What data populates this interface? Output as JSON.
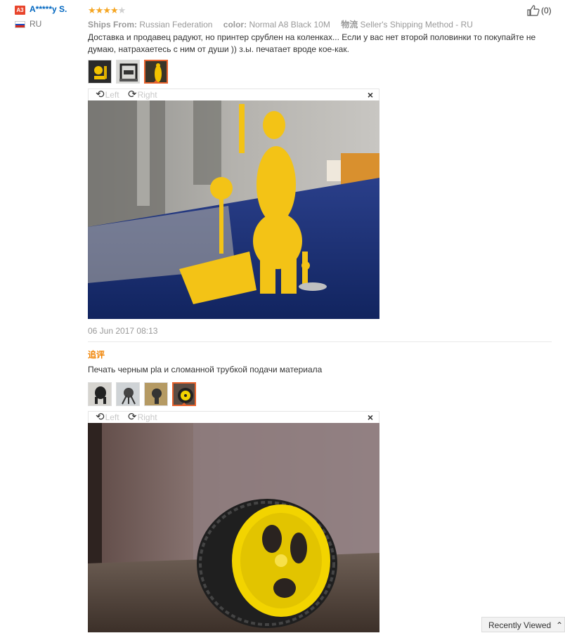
{
  "user": {
    "badge": "A3",
    "name": "A*****y S.",
    "country": "RU"
  },
  "review": {
    "rating": 4,
    "rating_max": 5,
    "ships_from_label": "Ships From:",
    "ships_from_value": "Russian Federation",
    "color_label": "color:",
    "color_value": "Normal A8 Black 10M",
    "shipping_label": "物流",
    "shipping_value": "Seller's Shipping Method - RU",
    "helpful_count": "(0)",
    "text": "Доставка и продавец радуют, но принтер срублен на коленках... Если у вас нет второй половинки то покупайте не думаю, натрахаетесь с ним от души )) з.ы. печатает вроде кое-как.",
    "date": "06 Jun 2017 08:13"
  },
  "viewer": {
    "left_label": "Left",
    "right_label": "Right",
    "close_symbol": "×"
  },
  "followup": {
    "label": "追评",
    "text": "Печать черным pla и сломанной трубкой подачи материала"
  },
  "footer": {
    "recently_viewed": "Recently Viewed"
  },
  "colors": {
    "accent": "#e8622c",
    "link": "#0066c0",
    "followup": "#f08200",
    "star": "#f5a623"
  }
}
